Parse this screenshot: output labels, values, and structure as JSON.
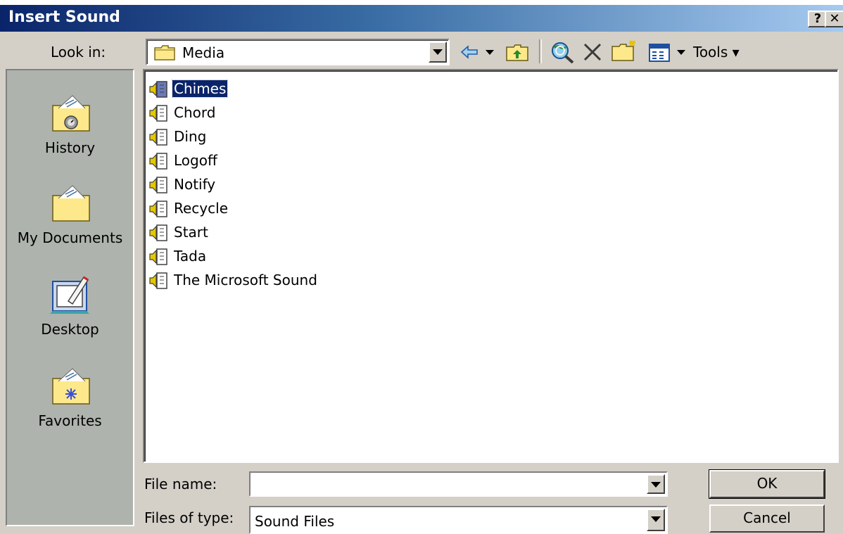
{
  "window": {
    "title": "Insert Sound",
    "help_label": "?",
    "close_label": "✕"
  },
  "toolbar": {
    "look_in_label": "Look in:",
    "look_in_value": "Media",
    "tools_label": "Tools ▾"
  },
  "places": [
    {
      "label": "History",
      "icon": "history-folder-icon"
    },
    {
      "label": "My Documents",
      "icon": "my-documents-folder-icon"
    },
    {
      "label": "Desktop",
      "icon": "desktop-icon"
    },
    {
      "label": "Favorites",
      "icon": "favorites-folder-icon"
    }
  ],
  "files": [
    {
      "name": "Chimes",
      "selected": true
    },
    {
      "name": "Chord"
    },
    {
      "name": "Ding"
    },
    {
      "name": "Logoff"
    },
    {
      "name": "Notify"
    },
    {
      "name": "Recycle"
    },
    {
      "name": "Start"
    },
    {
      "name": "Tada"
    },
    {
      "name": "The Microsoft Sound"
    }
  ],
  "form": {
    "file_name_label": "File name:",
    "file_name_value": "",
    "files_of_type_label": "Files of type:",
    "files_of_type_value": "Sound Files"
  },
  "buttons": {
    "ok": "OK",
    "cancel": "Cancel"
  },
  "colors": {
    "title_start": "#0a246a",
    "selection": "#0a246a",
    "places_bg": "#aeb3ad",
    "dialog_bg": "#d4d0c8"
  }
}
